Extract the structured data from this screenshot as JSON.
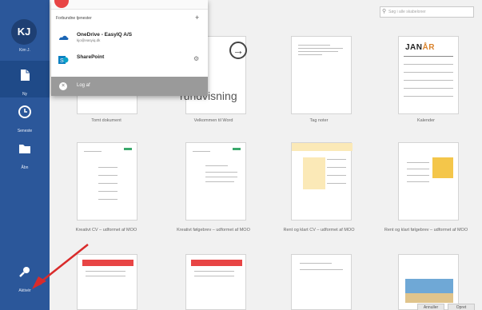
{
  "sidebar": {
    "avatar_initials": "KJ",
    "avatar_name": "Kim J.",
    "new_label": "Ny",
    "recent_label": "Seneste",
    "open_label": "Åbn",
    "bottom_label": "Aktivér"
  },
  "search": {
    "placeholder": "Søg i alle skabeloner"
  },
  "popup": {
    "header": "Forbundne tjenester",
    "services": [
      {
        "title": "OneDrive - EasyIQ A/S",
        "subtitle": "kjo@easyiq.dk",
        "icon": "onedrive-icon"
      },
      {
        "title": "SharePoint",
        "subtitle": "",
        "icon": "sharepoint-icon"
      }
    ],
    "logout_label": "Log af"
  },
  "templates": {
    "row1": [
      {
        "caption": "Tomt dokument"
      },
      {
        "caption": "Velkommen til Word",
        "preview_text": "n rundvisning"
      },
      {
        "caption": "Tag noter"
      },
      {
        "caption": "Kalender",
        "preview_title_a": "JAN",
        "preview_title_b": "ÅR"
      }
    ],
    "row2": [
      {
        "caption": "Kreativt CV – udformet af MOO"
      },
      {
        "caption": "Kreativt følgebrev – udformet af MOO"
      },
      {
        "caption": "Rent og klart CV – udformet af MOO"
      },
      {
        "caption": "Rent og klart følgebrev – udformet af MOO"
      }
    ]
  },
  "buttons": {
    "cancel": "Annuller",
    "open": "Opret"
  },
  "colors": {
    "sidebar": "#2b579a",
    "accent_red": "#e84545",
    "accent_yellow": "#f4c64a"
  }
}
